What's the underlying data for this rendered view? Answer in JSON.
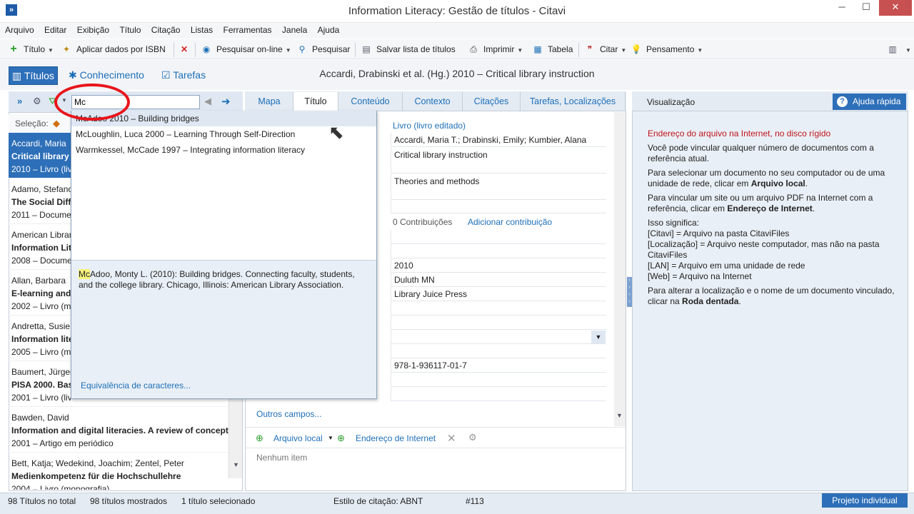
{
  "window": {
    "title": "Information Literacy: Gestão de títulos - Citavi",
    "minimize": "─",
    "maximize": "☐",
    "close": "✕"
  },
  "menu": [
    "Arquivo",
    "Editar",
    "Exibição",
    "Título",
    "Citação",
    "Listas",
    "Ferramentas",
    "Janela",
    "Ajuda"
  ],
  "toolbar": {
    "titulo": "Título",
    "isbn": "Aplicar dados por ISBN",
    "online": "Pesquisar on-line",
    "pesquisar": "Pesquisar",
    "salvar": "Salvar lista de títulos",
    "imprimir": "Imprimir",
    "tabela": "Tabela",
    "citar": "Citar",
    "pensamento": "Pensamento"
  },
  "nav": {
    "titulos": "Títulos",
    "conhecimento": "Conhecimento",
    "tarefas": "Tarefas"
  },
  "reference_title": "Accardi, Drabinski et al. (Hg.) 2010 – Critical library instruction",
  "left": {
    "search_value": "Mc",
    "selection_label": "Seleção:",
    "items": [
      {
        "author": "Accardi, Maria",
        "title": "Critical library i",
        "year": "2010 – Livro (liv"
      },
      {
        "author": "Adamo, Stefano",
        "title": "The Social Diffu",
        "year": "2011 – Docume"
      },
      {
        "author": "American Librar",
        "title": "Information Lit",
        "year": "2008 – Docume"
      },
      {
        "author": "Allan, Barbara",
        "title": "E-learning and",
        "year": "2002 – Livro (m"
      },
      {
        "author": "Andretta, Susie",
        "title": "Information lite",
        "year": "2005 – Livro (m"
      },
      {
        "author": "Baumert, Jürger",
        "title": "PISA 2000. Bas",
        "year": "2001 – Livro (liv"
      },
      {
        "author": "Bawden, David",
        "title": "Information and digital literacies. A review of concept",
        "year": "2001 – Artigo em periódico"
      },
      {
        "author": "Bett, Katja; Wedekind, Joachim; Zentel, Peter",
        "title": "Medienkompetenz für die Hochschullehre",
        "year": "2004 – Livro (monografia)"
      }
    ]
  },
  "suggestions": [
    "McAdoo 2010 – Building bridges",
    "McLoughlin, Luca 2000 – Learning Through Self-Direction",
    "Warmkessel, McCade 1997 – Integrating information literacy"
  ],
  "preview": {
    "highlight": "Mc",
    "text": "Adoo, Monty L. (2010): Building bridges. Connecting faculty, students, and the college library. Chicago, Illinois: American Library Association."
  },
  "equiv_link": "Equivalência de caracteres...",
  "center": {
    "tabs": [
      "Mapa",
      "Título",
      "Conteúdo",
      "Contexto",
      "Citações",
      "Tarefas, Localizações"
    ],
    "type_link": "Livro (livro editado)",
    "authors": "Accardi, Maria T.; Drabinski, Emily; Kumbier, Alana",
    "title": "Critical library instruction",
    "subtitle": "Theories and methods",
    "contrib_count": "0 Contribuições",
    "contrib_add": "Adicionar contribuição",
    "year": "2010",
    "place": "Duluth MN",
    "publisher": "Library Juice Press",
    "isbn": "978-1-936117-01-7",
    "more_fields": "Outros campos...",
    "local_file": "Arquivo local",
    "internet_addr": "Endereço de Internet",
    "no_item": "Nenhum item"
  },
  "right": {
    "header": "Visualização",
    "quick_help": "Ajuda rápida",
    "heading": "Endereço do arquivo na Internet, no disco rígido",
    "p1": "Você pode vincular qualquer número de documentos com a referência atual.",
    "p2a": "Para selecionar um documento no seu computador ou de uma unidade de rede, clicar em ",
    "p2b": "Arquivo local",
    "p3a": "Para vincular um site ou um arquivo PDF na Internet com a referência, clicar em ",
    "p3b": "Endereço de Internet",
    "p4": "Isso significa:",
    "l1": "[Citavi] = Arquivo na pasta CitaviFiles",
    "l2": "[Localização] = Arquivo neste computador, mas não na pasta CitaviFiles",
    "l3": "[LAN] = Arquivo em uma unidade de rede",
    "l4": "[Web] = Arquivo na Internet",
    "p5a": "Para alterar a localização e o nome de um documento vinculado, clicar na ",
    "p5b": "Roda dentada"
  },
  "status": {
    "total": "98 Títulos no total",
    "shown": "98 títulos mostrados",
    "selected": "1 título selecionado",
    "style": "Estilo de citação: ABNT",
    "number": "#113",
    "project": "Projeto individual"
  },
  "colors": {
    "accent": "#2d6fb8",
    "heading_red": "#c0141b",
    "ring": "#e8151b"
  }
}
